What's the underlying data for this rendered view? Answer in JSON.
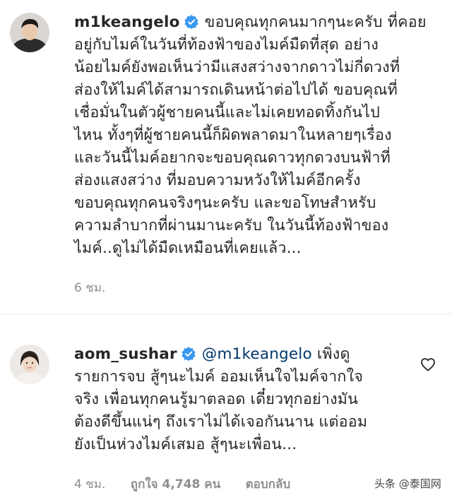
{
  "comments": [
    {
      "username": "m1keangelo",
      "text": "ขอบคุณทุกคนมากๆนะครับ ที่คอย\nอยู่กับไมค์ในวันที่ท้องฟ้าของไมค์มืดที่สุด อย่าง\nน้อยไมค์ยังพอเห็นว่ามีแสงสว่างจากดาวไม่กี่ดวงที่\nส่องให้ไมค์ได้สามารถเดินหน้าต่อไปได้ ขอบคุณที่\nเชื่อมั่นในตัวผู้ชายคนนี้และไม่เคยทอดทิ้งกันไป\nไหน ทั้งๆที่ผู้ชายคนนี้ก็ผิดพลาดมาในหลายๆเรื่อง\nและวันนี้ไมค์อยากจะขอบคุณดาวทุกดวงบนฟ้าที่\nส่องแสงสว่าง ที่มอบความหวังให้ไมค์อีกครั้ง\nขอบคุณทุกคนจริงๆนะครับ และขอโทษสำหรับ\nความลำบากที่ผ่านมานะครับ ในวันนี้ท้องฟ้าของ\nไมค์..ดูไม่ได้มืดเหมือนที่เคยแล้ว...",
      "time": "6 ชม."
    },
    {
      "username": "aom_sushar",
      "mention": "@m1keangelo",
      "text": " เพิ่งดู\nรายการจบ สู้ๆนะไมค์ ออมเห็นใจไมค์จากใจ\nจริง เพื่อนทุกคนรู้มาตลอด เดี๋ยวทุกอย่างมัน\nต้องดีขึ้นแน่ๆ ถึงเราไม่ได้เจอกันนาน แต่ออม\nยังเป็นห่วงไมค์เสมอ สู้ๆนะเพื่อน...",
      "time": "4 ชม.",
      "likes": "ถูกใจ 4,748 คน",
      "reply": "ตอบกลับ"
    }
  ],
  "watermark": "头条 @泰国网",
  "colors": {
    "verified": "#3897f0",
    "mention": "#00376b",
    "meta": "#8e8e8e"
  }
}
